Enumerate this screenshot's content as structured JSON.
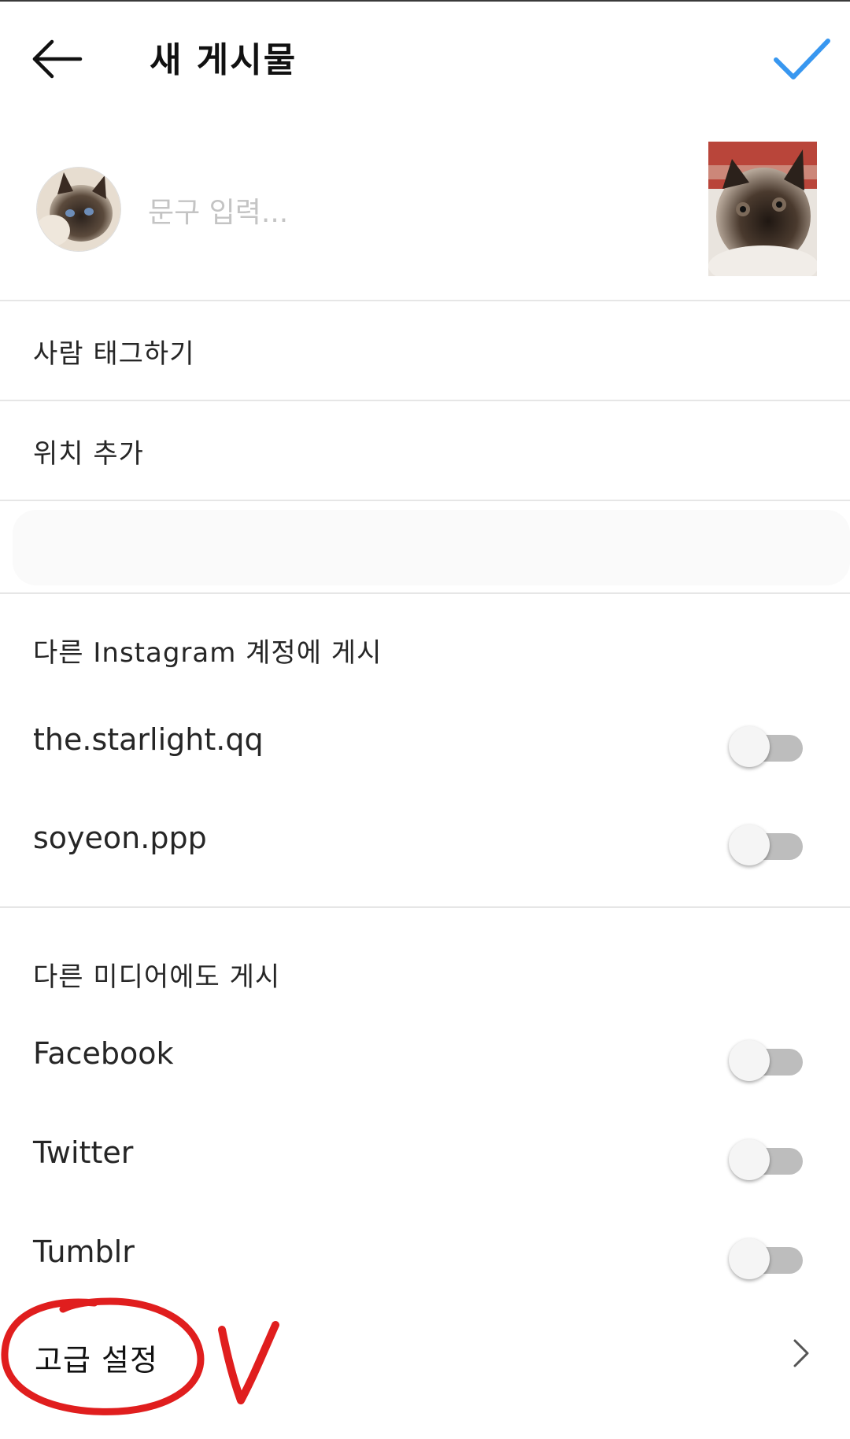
{
  "header": {
    "title": "새 게시물",
    "accent_color": "#3897f0"
  },
  "composer": {
    "caption_placeholder": "문구 입력...",
    "caption_value": ""
  },
  "menu": {
    "tag_people": "사람 태그하기",
    "add_location": "위치 추가"
  },
  "instagram_accounts": {
    "title": "다른 Instagram 계정에 게시",
    "accounts": [
      {
        "name": "the.starlight.qq",
        "enabled": false
      },
      {
        "name": "soyeon.ppp",
        "enabled": false
      }
    ]
  },
  "other_media": {
    "title": "다른 미디어에도 게시",
    "services": [
      {
        "name": "Facebook",
        "enabled": false
      },
      {
        "name": "Twitter",
        "enabled": false
      },
      {
        "name": "Tumblr",
        "enabled": false
      }
    ]
  },
  "advanced": {
    "label": "고급 설정"
  },
  "icons": {
    "back": "arrow-left-icon",
    "done": "checkmark-icon",
    "chevron": "chevron-right-icon"
  },
  "annotation_color": "#e01e1e"
}
